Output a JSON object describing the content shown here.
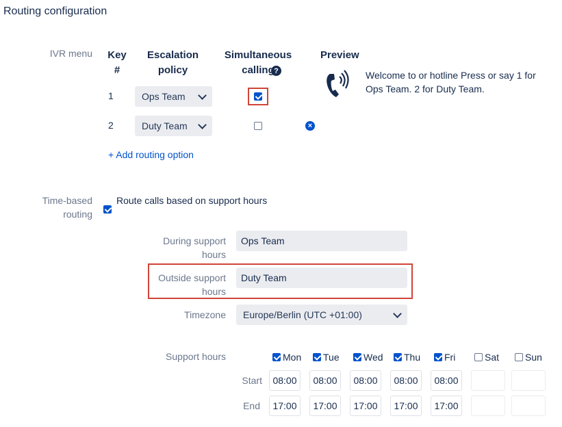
{
  "page_title": "Routing configuration",
  "ivr": {
    "label": "IVR menu",
    "headers": {
      "key": "Key\n#",
      "escalation": "Escalation\npolicy",
      "simultaneous": "Simultaneous\ncalling",
      "preview": "Preview"
    },
    "options": [
      {
        "key": "1",
        "policy": "Ops Team",
        "simultaneous": true
      },
      {
        "key": "2",
        "policy": "Duty Team",
        "simultaneous": false
      }
    ],
    "add_option": "+ Add routing option",
    "preview_text": "Welcome to or hotline Press or say 1 for Ops Team. 2 for Duty Team."
  },
  "time_based": {
    "label": "Time-based routing",
    "checkbox_label": "Route calls based on support hours",
    "enabled": true,
    "during_label": "During support hours",
    "during_value": "Ops Team",
    "outside_label": "Outside support hours",
    "outside_value": "Duty Team",
    "timezone_label": "Timezone",
    "timezone_value": "Europe/Berlin (UTC +01:00)"
  },
  "support_hours": {
    "label": "Support hours",
    "start_label": "Start",
    "end_label": "End",
    "days": [
      {
        "name": "Mon",
        "checked": true,
        "start": "08:00",
        "end": "17:00"
      },
      {
        "name": "Tue",
        "checked": true,
        "start": "08:00",
        "end": "17:00"
      },
      {
        "name": "Wed",
        "checked": true,
        "start": "08:00",
        "end": "17:00"
      },
      {
        "name": "Thu",
        "checked": true,
        "start": "08:00",
        "end": "17:00"
      },
      {
        "name": "Fri",
        "checked": true,
        "start": "08:00",
        "end": "17:00"
      },
      {
        "name": "Sat",
        "checked": false,
        "start": "",
        "end": ""
      },
      {
        "name": "Sun",
        "checked": false,
        "start": "",
        "end": ""
      }
    ]
  },
  "colors": {
    "accent": "#0052cc",
    "highlight": "#d04437",
    "field_bg": "#ebecf0",
    "label": "#6b778c"
  }
}
